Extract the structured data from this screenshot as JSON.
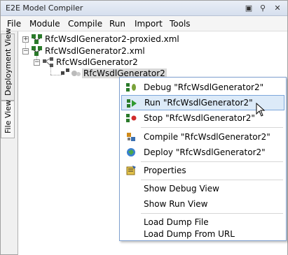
{
  "window": {
    "title": "E2E Model Compiler"
  },
  "menubar": [
    "File",
    "Module",
    "Compile",
    "Run",
    "Import",
    "Tools"
  ],
  "side_tabs": {
    "deployment": "Deployment View",
    "file": "File View"
  },
  "tree": {
    "nodes": [
      {
        "label": "RfcWsdlGenerator2-proxied.xml"
      },
      {
        "label": "RfcWsdlGenerator2.xml"
      },
      {
        "label": "RfcWsdlGenerator2"
      },
      {
        "label": "RfcWsdlGenerator2"
      }
    ]
  },
  "context_menu": {
    "items": [
      {
        "label": "Debug \"RfcWsdlGenerator2\"",
        "icon": "debug-icon"
      },
      {
        "label": "Run \"RfcWsdlGenerator2\"",
        "icon": "run-icon"
      },
      {
        "label": "Stop \"RfcWsdlGenerator2\"",
        "icon": "stop-icon"
      },
      {
        "label": "Compile \"RfcWsdlGenerator2\"",
        "icon": "compile-icon"
      },
      {
        "label": "Deploy \"RfcWsdlGenerator2\"",
        "icon": "deploy-icon"
      },
      {
        "label": "Properties",
        "icon": "properties-icon"
      },
      {
        "label": "Show Debug View"
      },
      {
        "label": "Show Run View"
      },
      {
        "label": "Load Dump File"
      },
      {
        "label": "Load Dump From URL"
      }
    ]
  },
  "colors": {
    "highlight": "#dceaf8",
    "highlight_border": "#7da7db",
    "menu_border": "#7fa0cf"
  }
}
